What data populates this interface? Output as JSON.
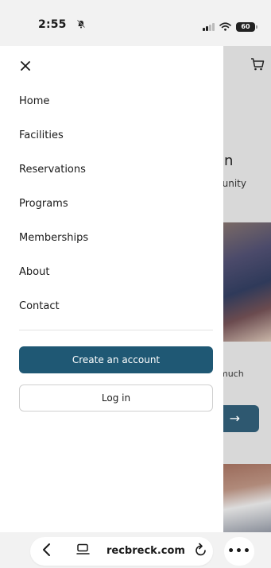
{
  "status_bar": {
    "time": "2:55",
    "battery": "60"
  },
  "drawer": {
    "nav_items": [
      {
        "label": "Home"
      },
      {
        "label": "Facilities"
      },
      {
        "label": "Reservations"
      },
      {
        "label": "Programs"
      },
      {
        "label": "Memberships"
      },
      {
        "label": "About"
      },
      {
        "label": "Contact"
      }
    ],
    "create_account_label": "Create an account",
    "login_label": "Log in"
  },
  "background_page": {
    "heading_fragment": "n",
    "text_fragment": "nunity",
    "text_fragment_2": "much"
  },
  "browser": {
    "url": "recbreck.com"
  },
  "colors": {
    "primary": "#1f5874",
    "drawer_bg": "#ffffff",
    "overlay_bg": "#d8d8d8"
  },
  "icons": [
    "close-icon",
    "cart-icon",
    "back-icon",
    "tabs-icon",
    "reload-icon",
    "more-icon",
    "bell-silent-icon",
    "signal-icon",
    "wifi-icon",
    "battery-icon"
  ]
}
